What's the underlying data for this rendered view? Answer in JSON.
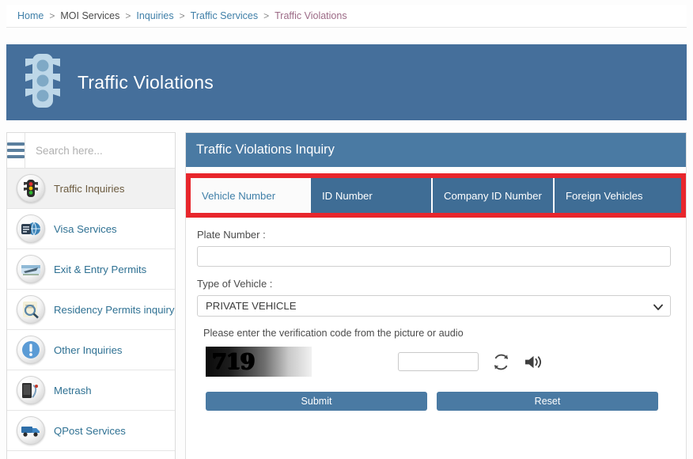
{
  "breadcrumb": {
    "items": [
      {
        "label": "Home",
        "type": "link"
      },
      {
        "label": "MOI Services",
        "type": "plain"
      },
      {
        "label": "Inquiries",
        "type": "link"
      },
      {
        "label": "Traffic Services",
        "type": "link"
      },
      {
        "label": "Traffic Violations",
        "type": "current"
      }
    ],
    "separator": ">"
  },
  "banner": {
    "title": "Traffic Violations",
    "icon": "traffic-light-icon",
    "bg_color": "#456f9b"
  },
  "sidebar": {
    "search": {
      "placeholder": "Search here...",
      "menu_icon": "hamburger-icon"
    },
    "items": [
      {
        "label": "Traffic Inquiries",
        "icon": "traffic-light-icon",
        "active": true
      },
      {
        "label": "Visa Services",
        "icon": "globe-passport-icon",
        "active": false
      },
      {
        "label": "Exit & Entry Permits",
        "icon": "airplane-ticket-icon",
        "active": false
      },
      {
        "label": "Residency Permits inquiry",
        "icon": "magnifier-document-icon",
        "active": false
      },
      {
        "label": "Other Inquiries",
        "icon": "exclamation-circle-icon",
        "active": false
      },
      {
        "label": "Metrash",
        "icon": "mobile-device-icon",
        "active": false
      },
      {
        "label": "QPost Services",
        "icon": "delivery-truck-icon",
        "active": false
      }
    ]
  },
  "main": {
    "panel_title": "Traffic Violations Inquiry",
    "panel_header_color": "#4a7aa3",
    "highlight_color": "#e8262c",
    "tabs": [
      {
        "label": "Vehicle Number",
        "active": true
      },
      {
        "label": "ID Number",
        "active": false
      },
      {
        "label": "Company ID Number",
        "active": false
      },
      {
        "label": "Foreign Vehicles",
        "active": false
      }
    ],
    "form": {
      "plate_label": "Plate Number :",
      "plate_value": "",
      "plate_placeholder": "",
      "vehicle_type_label": "Type of Vehicle :",
      "vehicle_type_value": "PRIVATE VEHICLE",
      "vehicle_type_options": [
        "PRIVATE VEHICLE"
      ],
      "captcha_hint": "Please enter the verification code from the picture or audio",
      "captcha_code": "719",
      "captcha_value": "",
      "captcha_placeholder": "",
      "refresh_icon": "refresh-icon",
      "audio_icon": "speaker-icon",
      "submit_label": "Submit",
      "reset_label": "Reset",
      "button_color": "#4a7aa3"
    }
  }
}
